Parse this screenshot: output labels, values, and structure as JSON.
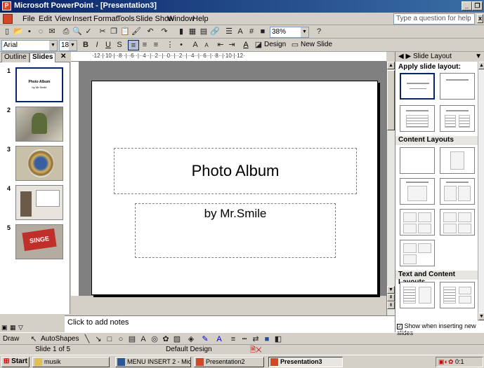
{
  "window": {
    "title": "Microsoft PowerPoint - [Presentation3]"
  },
  "menu": {
    "items": [
      "File",
      "Edit",
      "View",
      "Insert",
      "Format",
      "Tools",
      "Slide Show",
      "Window",
      "Help"
    ],
    "ask_placeholder": "Type a question for help"
  },
  "toolbar": {
    "zoom": "38%",
    "font": "Arial",
    "font_size": "18",
    "design_label": "Design",
    "new_slide_label": "New Slide"
  },
  "left_pane": {
    "tabs": [
      "Outline",
      "Slides"
    ],
    "thumb1_title": "Photo Album",
    "thumb1_sub": "by Mr.Smile",
    "thumb4_sign": "SINGE"
  },
  "slide": {
    "title": "Photo Album",
    "subtitle": "by Mr.Smile"
  },
  "notes": {
    "placeholder": "Click to add notes"
  },
  "task_pane": {
    "title": "Slide Layout",
    "apply_label": "Apply slide layout:",
    "section_content": "Content Layouts",
    "section_text_content": "Text and Content Layouts",
    "show_when_inserting": "Show when inserting new slides"
  },
  "draw_toolbar": {
    "draw_label": "Draw",
    "autoshapes_label": "AutoShapes"
  },
  "status": {
    "slide_of": "Slide 1 of 5",
    "design": "Default Design"
  },
  "taskbar": {
    "start": "Start",
    "items": [
      "musik",
      "MENU INSERT 2 - Micros...",
      "Presentation2",
      "Presentation3"
    ],
    "clock": "0:1"
  },
  "colors": {
    "titlebar": "#0a246a",
    "accent": "#d24726",
    "face": "#d4d0c8"
  }
}
